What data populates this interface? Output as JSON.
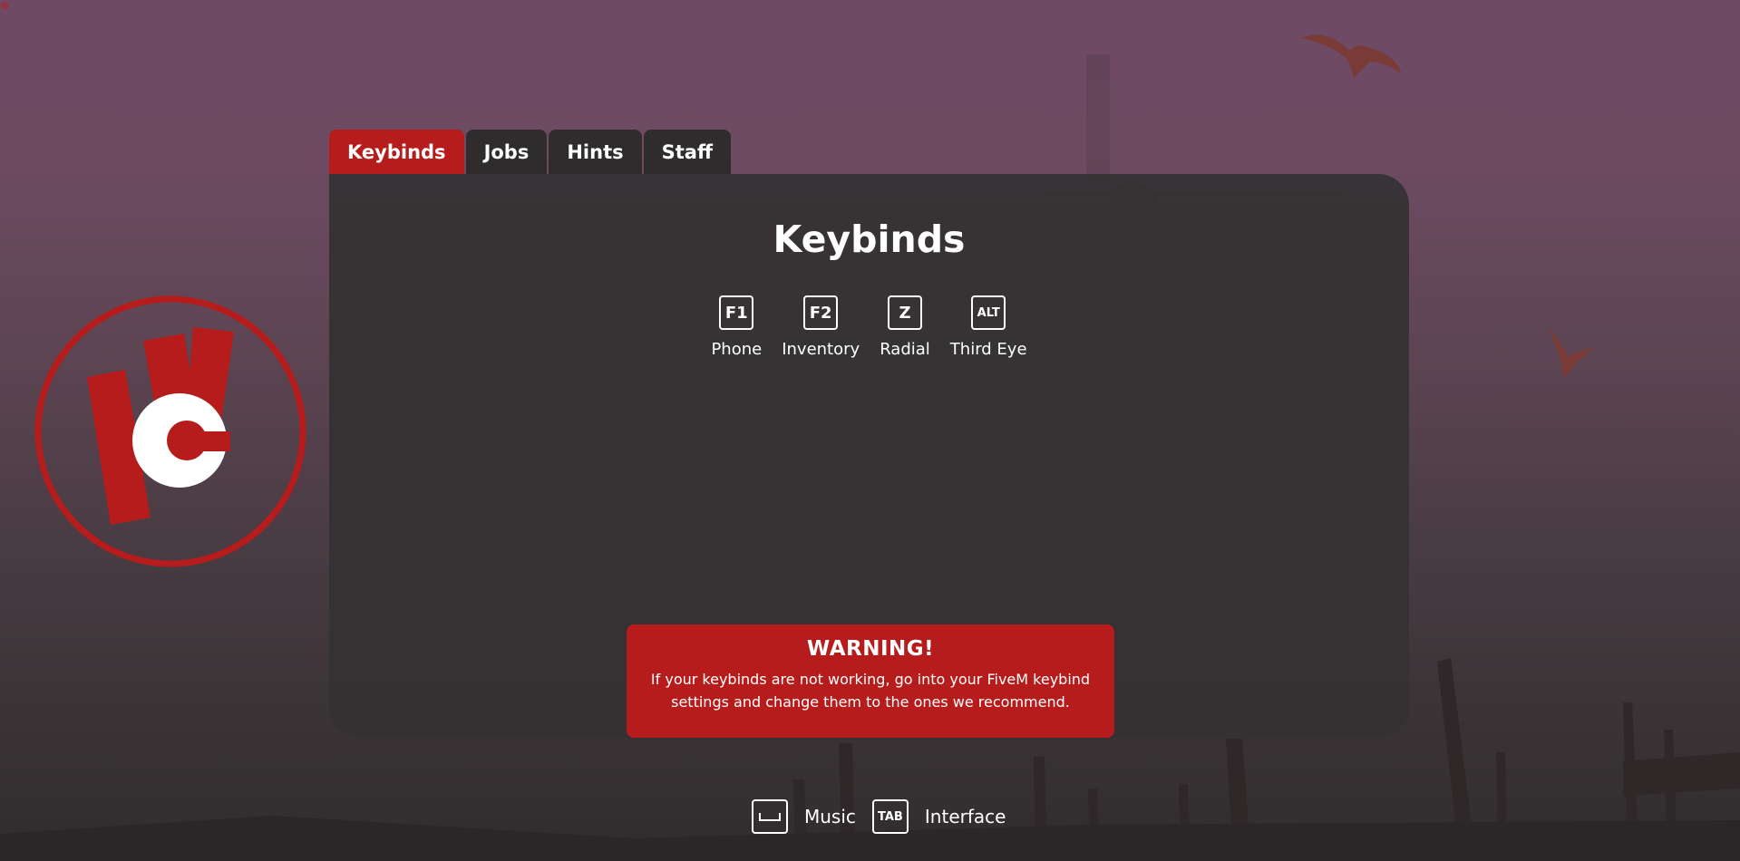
{
  "tabs": [
    {
      "label": "Keybinds",
      "active": true
    },
    {
      "label": "Jobs",
      "active": false
    },
    {
      "label": "Hints",
      "active": false
    },
    {
      "label": "Staff",
      "active": false
    }
  ],
  "panel": {
    "title": "Keybinds",
    "keys": [
      {
        "key": "F1",
        "label": "Phone"
      },
      {
        "key": "F2",
        "label": "Inventory"
      },
      {
        "key": "Z",
        "label": "Radial"
      },
      {
        "key": "ALT",
        "label": "Third Eye"
      }
    ]
  },
  "warning": {
    "title": "WARNING!",
    "text": "If your keybinds are not working, go into your FiveM keybind settings and change them to the ones we recommend."
  },
  "footer": {
    "music_key": "space",
    "music_label": "Music",
    "interface_key": "TAB",
    "interface_label": "Interface"
  },
  "colors": {
    "accent": "#b71c1c",
    "panel": "#343233",
    "tab_inactive": "#2e2c2d"
  },
  "logo": {
    "icon": "wc-logo-icon"
  }
}
